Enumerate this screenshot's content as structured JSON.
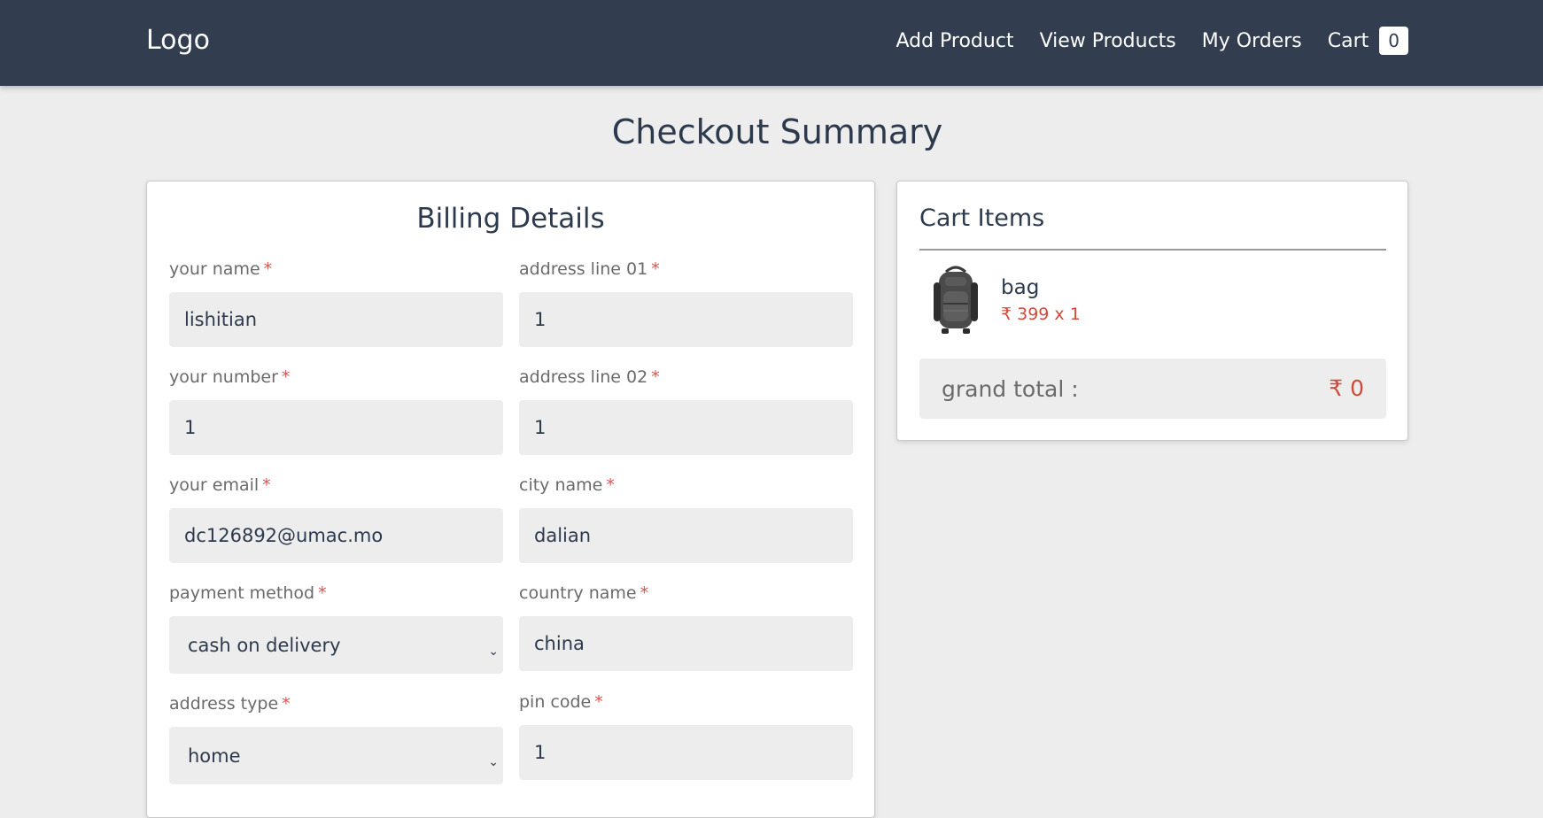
{
  "header": {
    "logo": "Logo",
    "nav": [
      "Add Product",
      "View Products",
      "My Orders"
    ],
    "cart_label": "Cart",
    "cart_count": "0"
  },
  "page": {
    "title": "Checkout Summary"
  },
  "billing": {
    "title": "Billing Details",
    "required_mark": "*",
    "fields": {
      "name": {
        "label": "your name",
        "value": "lishitian"
      },
      "address1": {
        "label": "address line 01",
        "value": "1"
      },
      "number": {
        "label": "your number",
        "value": "1"
      },
      "address2": {
        "label": "address line 02",
        "value": "1"
      },
      "email": {
        "label": "your email",
        "value": "dc126892@umac.mo"
      },
      "city": {
        "label": "city name",
        "value": "dalian"
      },
      "payment": {
        "label": "payment method",
        "value": "cash on delivery"
      },
      "country": {
        "label": "country name",
        "value": "china"
      },
      "address_type": {
        "label": "address type",
        "value": "home"
      },
      "pin": {
        "label": "pin code",
        "value": "1"
      }
    }
  },
  "cart": {
    "title": "Cart Items",
    "items": [
      {
        "name": "bag",
        "price": "₹ 399 x 1",
        "image": "backpack-image"
      }
    ],
    "grand_total_label": "grand total :",
    "grand_total_value": "₹ 0"
  },
  "colors": {
    "header_bg": "#323d4f",
    "page_bg": "#ededed",
    "accent_red": "#d04b3a",
    "text_dark": "#2d3a4d"
  }
}
